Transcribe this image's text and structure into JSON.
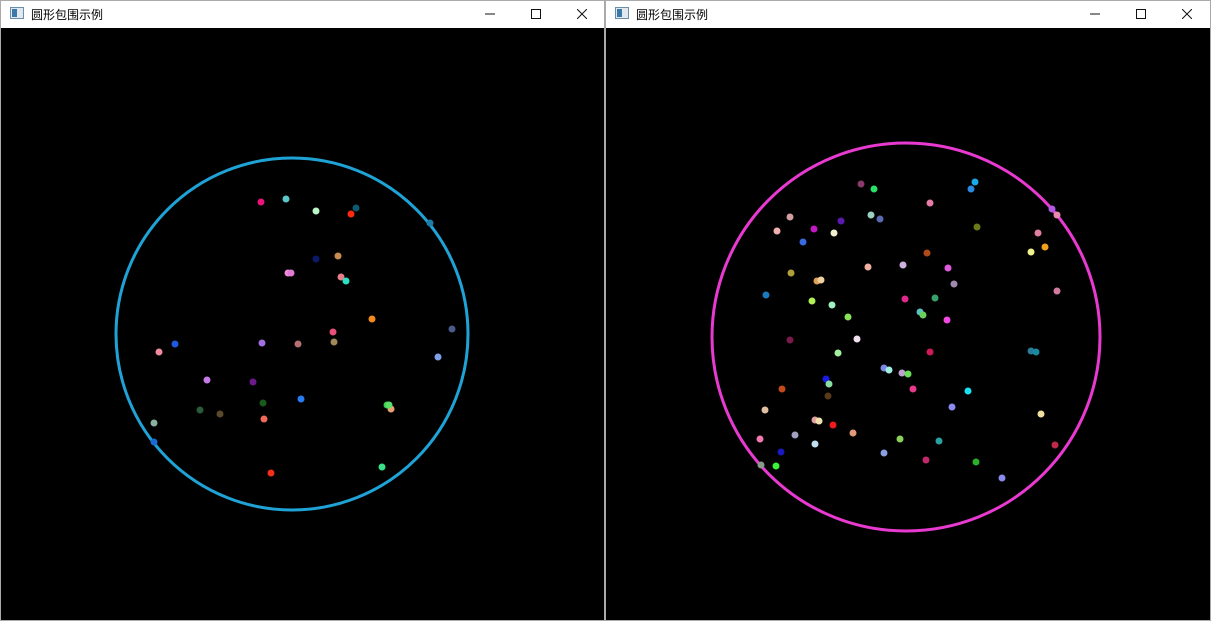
{
  "windows": [
    {
      "title": "圆形包围示例",
      "controls": {
        "minimize": "minimize",
        "maximize": "maximize",
        "close": "close"
      },
      "circle_color": "#1fa3d6",
      "point_count": 32
    },
    {
      "title": "圆形包围示例",
      "controls": {
        "minimize": "minimize",
        "maximize": "maximize",
        "close": "close"
      },
      "circle_color": "#e83ad0",
      "point_count": 77
    }
  ],
  "icons": {
    "app": "app-window-icon",
    "minimize": "minimize-icon",
    "maximize": "maximize-icon",
    "close": "close-icon"
  }
}
